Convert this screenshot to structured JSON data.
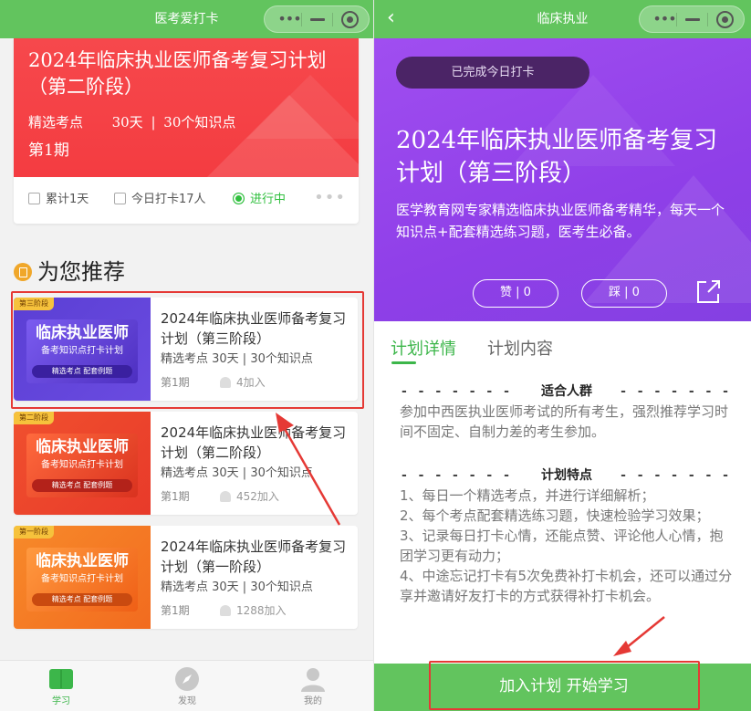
{
  "left": {
    "titlebar": {
      "title": "医考爱打卡"
    },
    "current_plan": {
      "title": "2024年临床执业医师备考复习计划（第二阶段）",
      "meta_a": "精选考点",
      "meta_b": "30天",
      "meta_sep": "|",
      "meta_c": "30个知识点",
      "period": "第1期",
      "stat_total": "累计1天",
      "stat_today": "今日打卡17人",
      "stat_status": "进行中",
      "more": "•••"
    },
    "recommend": {
      "title": "为您推荐",
      "items": [
        {
          "tag": "第三阶段",
          "thumb_big": "临床执业医师",
          "thumb_sub": "备考知识点打卡计划",
          "thumb_pill": "精选考点   配套例题",
          "title": "2024年临床执业医师备考复习计划（第三阶段）",
          "meta": "精选考点  30天 | 30个知识点",
          "period": "第1期",
          "joined": "4加入"
        },
        {
          "tag": "第二阶段",
          "thumb_big": "临床执业医师",
          "thumb_sub": "备考知识点打卡计划",
          "thumb_pill": "精选考点   配套例题",
          "title": "2024年临床执业医师备考复习计划（第二阶段）",
          "meta": "精选考点  30天 | 30个知识点",
          "period": "第1期",
          "joined": "452加入"
        },
        {
          "tag": "第一阶段",
          "thumb_big": "临床执业医师",
          "thumb_sub": "备考知识点打卡计划",
          "thumb_pill": "精选考点   配套例题",
          "title": "2024年临床执业医师备考复习计划（第一阶段）",
          "meta": "精选考点  30天 | 30个知识点",
          "period": "第1期",
          "joined": "1288加入"
        }
      ]
    },
    "tabbar": {
      "study": "学习",
      "discover": "发现",
      "mine": "我的"
    }
  },
  "right": {
    "titlebar": {
      "title": "临床执业",
      "back": "‹"
    },
    "hero": {
      "done": "已完成今日打卡",
      "title": "2024年临床执业医师备考复习计划（第三阶段）",
      "desc": "医学教育网专家精选临床执业医师备考精华，每天一个知识点+配套精选练习题，医考生必备。",
      "like": "赞 | 0",
      "dislike": "踩 | 0"
    },
    "tabs": {
      "detail": "计划详情",
      "content": "计划内容"
    },
    "section1": {
      "dash": "- - - - - - -",
      "heading": "适合人群",
      "text": "参加中西医执业医师考试的所有考生，强烈推荐学习时间不固定、自制力差的考生参加。"
    },
    "section2": {
      "dash": "- - - - - - -",
      "heading": "计划特点",
      "points": [
        "1、每日一个精选考点，并进行详细解析；",
        "2、每个考点配套精选练习题，快速检验学习效果；",
        "3、记录每日打卡心情，还能点赞、评论他人心情，抱团学习更有动力；",
        "4、中途忘记打卡有5次免费补打卡机会，还可以通过分享并邀请好友打卡的方式获得补打卡机会。"
      ]
    },
    "join_button": "加入计划 开始学习"
  },
  "colors": {
    "green": "#62c45e",
    "red_banner": "#f4464a",
    "purple_hero": "#9646ec",
    "annotation_red": "#e53935"
  }
}
